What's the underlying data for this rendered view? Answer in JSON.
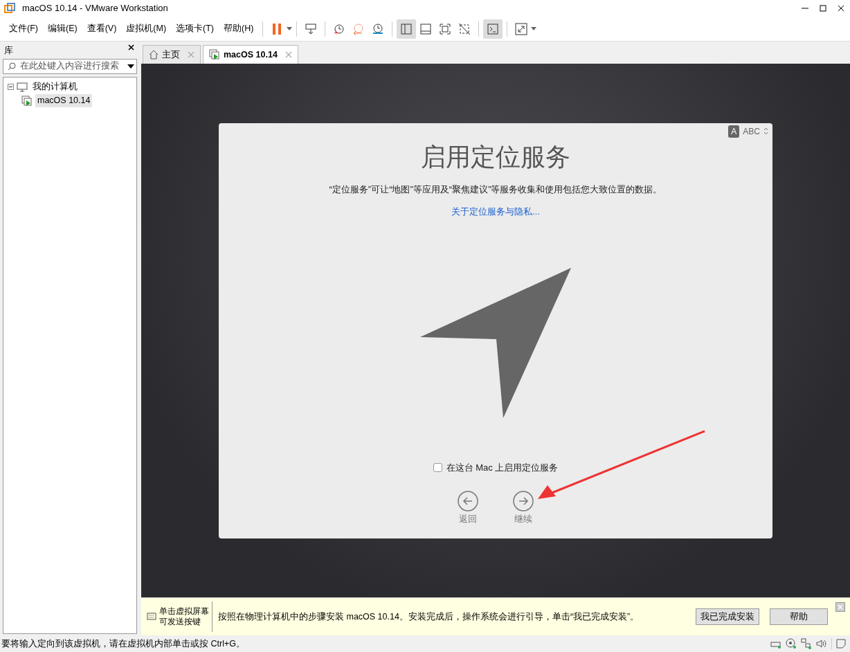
{
  "window": {
    "title": "macOS 10.14 - VMware Workstation"
  },
  "menu": [
    "文件(F)",
    "编辑(E)",
    "查看(V)",
    "虚拟机(M)",
    "选项卡(T)",
    "帮助(H)"
  ],
  "view_buttons": [
    {
      "selected": true
    },
    {
      "selected": false
    },
    {
      "selected": false
    },
    {
      "selected": false
    }
  ],
  "console_button": {
    "selected": true
  },
  "library": {
    "title": "库",
    "search": {
      "placeholder": "在此处键入内容进行搜索"
    },
    "tree": [
      {
        "label": "我的计算机",
        "expanded": true,
        "selected": false,
        "children": [
          {
            "label": "macOS 10.14",
            "selected": true
          }
        ]
      }
    ]
  },
  "tabs": [
    {
      "label": "主页",
      "kind": "home",
      "selected": false
    },
    {
      "label": "macOS 10.14",
      "kind": "vm",
      "selected": true
    }
  ],
  "dialog": {
    "input_badge": "A",
    "input_label": "ABC",
    "title": "启用定位服务",
    "description": "“定位服务”可让“地图”等应用及“聚焦建议”等服务收集和使用包括您大致位置的数据。",
    "link": "关于定位服务与隐私...",
    "checkbox": {
      "label": "在这台 Mac 上启用定位服务",
      "checked": false
    },
    "nav": [
      {
        "kind": "back",
        "label": "返回"
      },
      {
        "kind": "forward",
        "label": "继续"
      }
    ]
  },
  "hint_bar": {
    "tip": "单击虚拟屏幕可发送按键",
    "message": "按照在物理计算机中的步骤安装 macOS 10.14。安装完成后，操作系统会进行引导，单击“我已完成安装”。",
    "buttons": [
      "我已完成安装",
      "帮助"
    ]
  },
  "status_bar": {
    "text": "要将输入定向到该虚拟机，请在虚拟机内部单击或按 Ctrl+G。"
  }
}
